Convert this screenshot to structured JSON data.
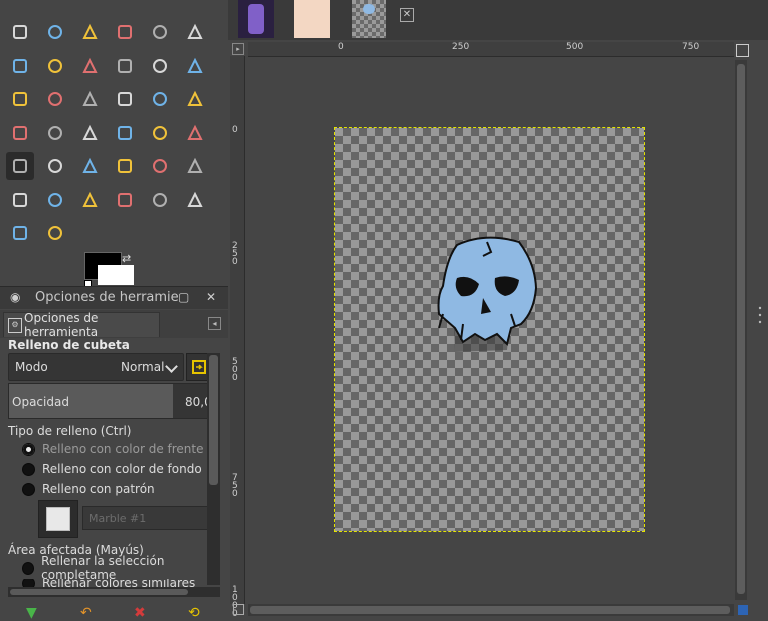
{
  "toolbox": {
    "tools": [
      {
        "name": "rect-select-icon"
      },
      {
        "name": "ellipse-select-icon"
      },
      {
        "name": "lasso-icon"
      },
      {
        "name": "fuzzy-select-icon"
      },
      {
        "name": "color-select-icon"
      },
      {
        "name": "scissors-icon"
      },
      {
        "name": "foreground-select-icon"
      },
      {
        "name": "paths-icon"
      },
      {
        "name": "color-picker-icon"
      },
      {
        "name": "zoom-icon"
      },
      {
        "name": "measure-icon"
      },
      {
        "name": "move-icon"
      },
      {
        "name": "align-icon"
      },
      {
        "name": "crop-icon"
      },
      {
        "name": "unified-transform-icon"
      },
      {
        "name": "rotate-icon"
      },
      {
        "name": "scale-icon"
      },
      {
        "name": "shear-icon"
      },
      {
        "name": "perspective-icon"
      },
      {
        "name": "3d-transform-icon"
      },
      {
        "name": "flip-icon"
      },
      {
        "name": "cage-icon"
      },
      {
        "name": "warp-icon"
      },
      {
        "name": "text-icon"
      },
      {
        "name": "bucket-fill-icon"
      },
      {
        "name": "gradient-icon"
      },
      {
        "name": "pencil-icon"
      },
      {
        "name": "paintbrush-icon"
      },
      {
        "name": "eraser-icon"
      },
      {
        "name": "airbrush-icon"
      },
      {
        "name": "ink-icon"
      },
      {
        "name": "mypaint-brush-icon"
      },
      {
        "name": "clone-icon"
      },
      {
        "name": "heal-icon"
      },
      {
        "name": "perspective-clone-icon"
      },
      {
        "name": "blur-icon"
      },
      {
        "name": "smudge-icon"
      },
      {
        "name": "dodge-burn-icon"
      }
    ],
    "foreground_color": "#000000",
    "background_color": "#ffffff"
  },
  "dock": {
    "title": "Opciones de herramie",
    "tab_label": "Opciones de herramienta"
  },
  "options": {
    "title": "Relleno de cubeta",
    "mode_label": "Modo",
    "mode_value": "Normal",
    "opacity_label": "Opacidad",
    "opacity_value": "80,0",
    "opacity_fraction": 0.8,
    "fill_type_title": "Tipo de relleno  (Ctrl)",
    "fill_types": [
      {
        "label": "Relleno con color de frente",
        "checked": true
      },
      {
        "label": "Relleno con color de fondo",
        "checked": false
      },
      {
        "label": "Relleno con patrón",
        "checked": false
      }
    ],
    "pattern_name": "Marble #1",
    "area_title": "Área afectada  (Mayús)",
    "area_options": [
      {
        "label": "Rellenar la selección completame"
      },
      {
        "label": "Rellenar colores similares"
      }
    ]
  },
  "rulers": {
    "h_ticks": [
      "0",
      "250",
      "500",
      "750"
    ],
    "v_ticks": [
      "0",
      "250",
      "500",
      "750",
      "1000"
    ]
  },
  "colors": {
    "accent_blue": "#2d64b4",
    "selection_marching_ants": "#e6e600",
    "skull_blue": "#8fb9e3"
  }
}
